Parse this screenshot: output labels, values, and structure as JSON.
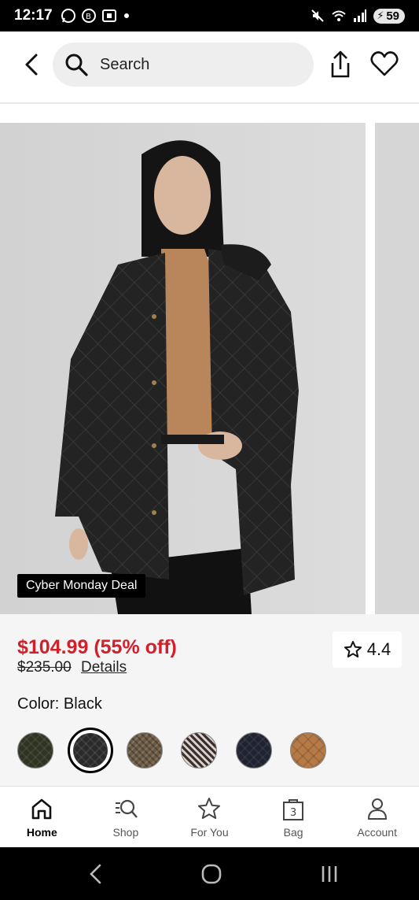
{
  "status_bar": {
    "time": "12:17",
    "battery": "59",
    "icons": [
      "whatsapp-icon",
      "whatsapp-business-icon",
      "screenshot-icon",
      "dot-icon",
      "mute-icon",
      "wifi-icon",
      "signal-icon",
      "battery-icon"
    ]
  },
  "header": {
    "search_placeholder": "Search",
    "icons": [
      "back-icon",
      "search-icon",
      "share-icon",
      "heart-icon"
    ]
  },
  "gallery": {
    "badge": "Cyber Monday Deal"
  },
  "product": {
    "sale_price": "$104.99 (55% off)",
    "original_price": "$235.00",
    "details_link": "Details",
    "rating": "4.4",
    "color_label": "Color: Black",
    "swatches": [
      {
        "name": "olive",
        "color": "#2e3322"
      },
      {
        "name": "black",
        "color": "#2a2a2a",
        "selected": true
      },
      {
        "name": "brown-tweed",
        "color": "#6b5a44"
      },
      {
        "name": "houndstooth",
        "color": "#7a6e68"
      },
      {
        "name": "navy",
        "color": "#1f2230"
      },
      {
        "name": "tan",
        "color": "#b67a46"
      }
    ]
  },
  "bottom_nav": {
    "items": [
      {
        "label": "Home",
        "icon": "home-icon",
        "active": true
      },
      {
        "label": "Shop",
        "icon": "shop-search-icon"
      },
      {
        "label": "For You",
        "icon": "star-icon"
      },
      {
        "label": "Bag",
        "icon": "bag-icon",
        "count": "3"
      },
      {
        "label": "Account",
        "icon": "person-icon"
      }
    ]
  },
  "colors": {
    "sale_red": "#d0202b",
    "search_bg": "#eeeeee",
    "info_bg": "#f5f5f5"
  }
}
